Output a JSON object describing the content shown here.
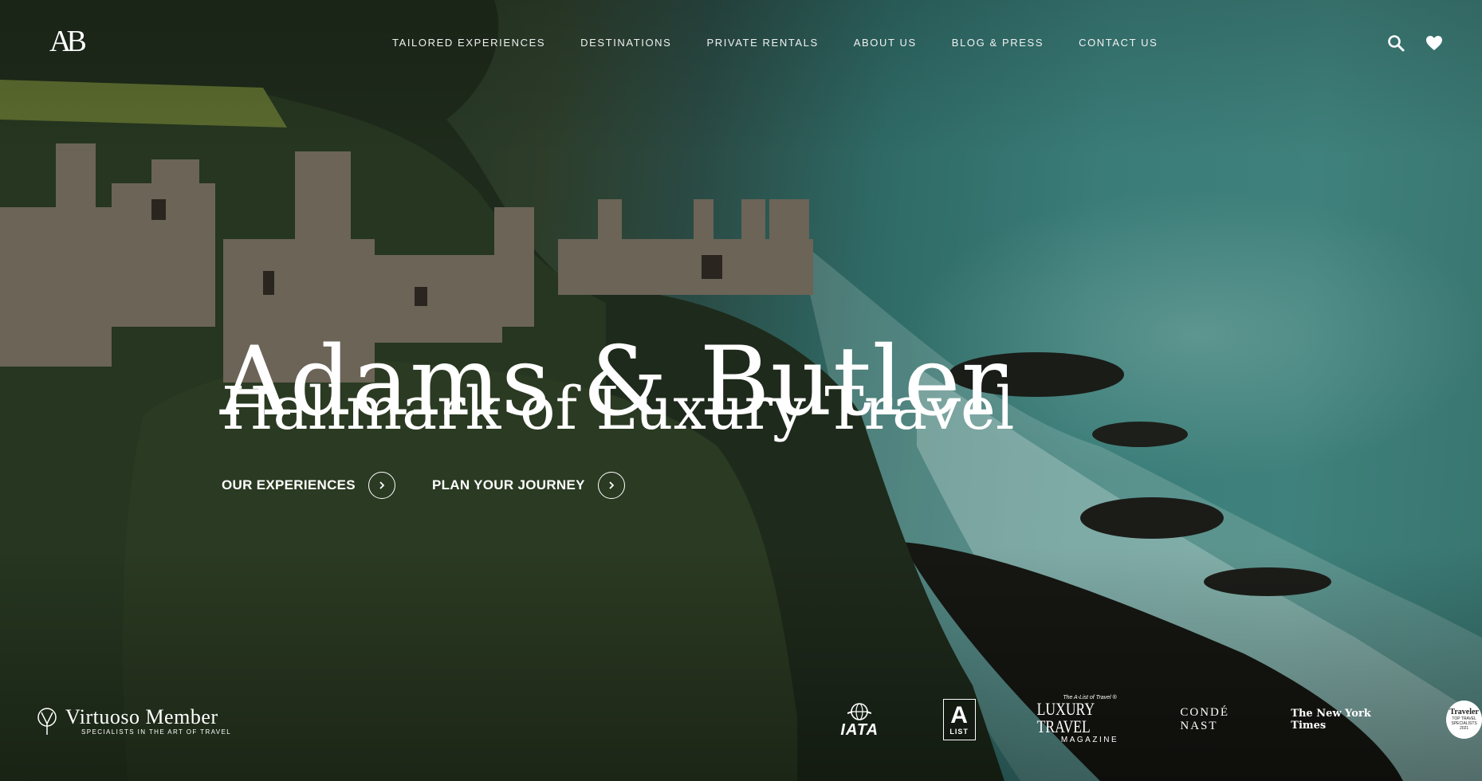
{
  "brand": {
    "logo_text": "AB"
  },
  "nav": {
    "links": [
      {
        "label": "TAILORED EXPERIENCES"
      },
      {
        "label": "DESTINATIONS"
      },
      {
        "label": "PRIVATE RENTALS"
      },
      {
        "label": "ABOUT US"
      },
      {
        "label": "BLOG & PRESS"
      },
      {
        "label": "CONTACT US"
      }
    ],
    "icons": [
      "search-icon",
      "heart-icon"
    ]
  },
  "hero": {
    "title": "Adams & Butler",
    "subtitle": "Hallmark of Luxury Travel",
    "ctas": [
      {
        "label": "OUR EXPERIENCES"
      },
      {
        "label": "PLAN YOUR JOURNEY"
      }
    ]
  },
  "footer": {
    "virtuoso": {
      "name": "Virtuoso Member",
      "tagline": "SPECIALISTS IN THE ART OF TRAVEL"
    },
    "press": {
      "iata": "IATA",
      "alist": {
        "letter": "A",
        "word": "LIST"
      },
      "ltm": {
        "top": "The A-List of Travel ®",
        "main": "LUXURY TRAVEL",
        "sub": "MAGAZINE"
      },
      "conde": "CONDÉ NAST",
      "nyt": "The New York Times",
      "traveler": {
        "name": "Traveler",
        "line": "TOP TRAVEL SPECIALISTS",
        "year": "2021"
      }
    }
  },
  "colors": {
    "text": "#ffffff",
    "sea": "#3a7c78",
    "cliff": "#223322"
  }
}
